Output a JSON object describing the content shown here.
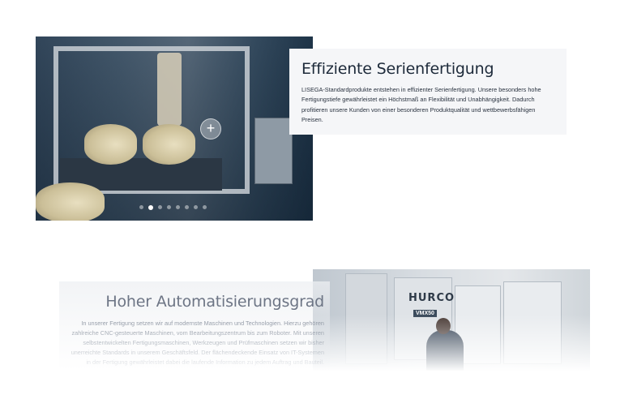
{
  "section1": {
    "title": "Effiziente Serienfertigung",
    "text": "LISEGA-Standardprodukte entstehen in effizienter Serienfertigung. Unsere besonders hohe Fertigungstiefe gewährleistet ein Höchstmaß an Flexibilität und Unabhängigkeit. Dadurch profitieren unsere Kunden von einer besonderen Produktqualität und wettbewerbsfähigen Preisen.",
    "plus_icon": "plus-icon",
    "carousel": {
      "count": 8,
      "active_index": 1
    }
  },
  "section2": {
    "title": "Hoher Automatisierungsgrad",
    "text": "In unserer Fertigung setzen wir auf modernste Maschinen und Technologien. Hierzu gehören zahlreiche CNC-gesteuerte Maschinen, vom Bearbeitungszentrum bis zum Roboter. Mit unseren selbstentwickelten Fertigungsmaschinen, Werkzeugen und Prüfmaschinen setzen wir bisher unerreichte Standards in unserem Geschäftsfeld. Der flächendeckende Einsatz von IT-Systemen in der Fertigung gewährleistet dabei die laufende Information zu jedem Auftrag und Bauteil.",
    "machine_brand": "HURCO",
    "machine_model": "VMX50"
  },
  "colors": {
    "title_dark": "#1d2a3a",
    "title_muted": "#6d7585",
    "card_bg": "#f5f6f8"
  }
}
